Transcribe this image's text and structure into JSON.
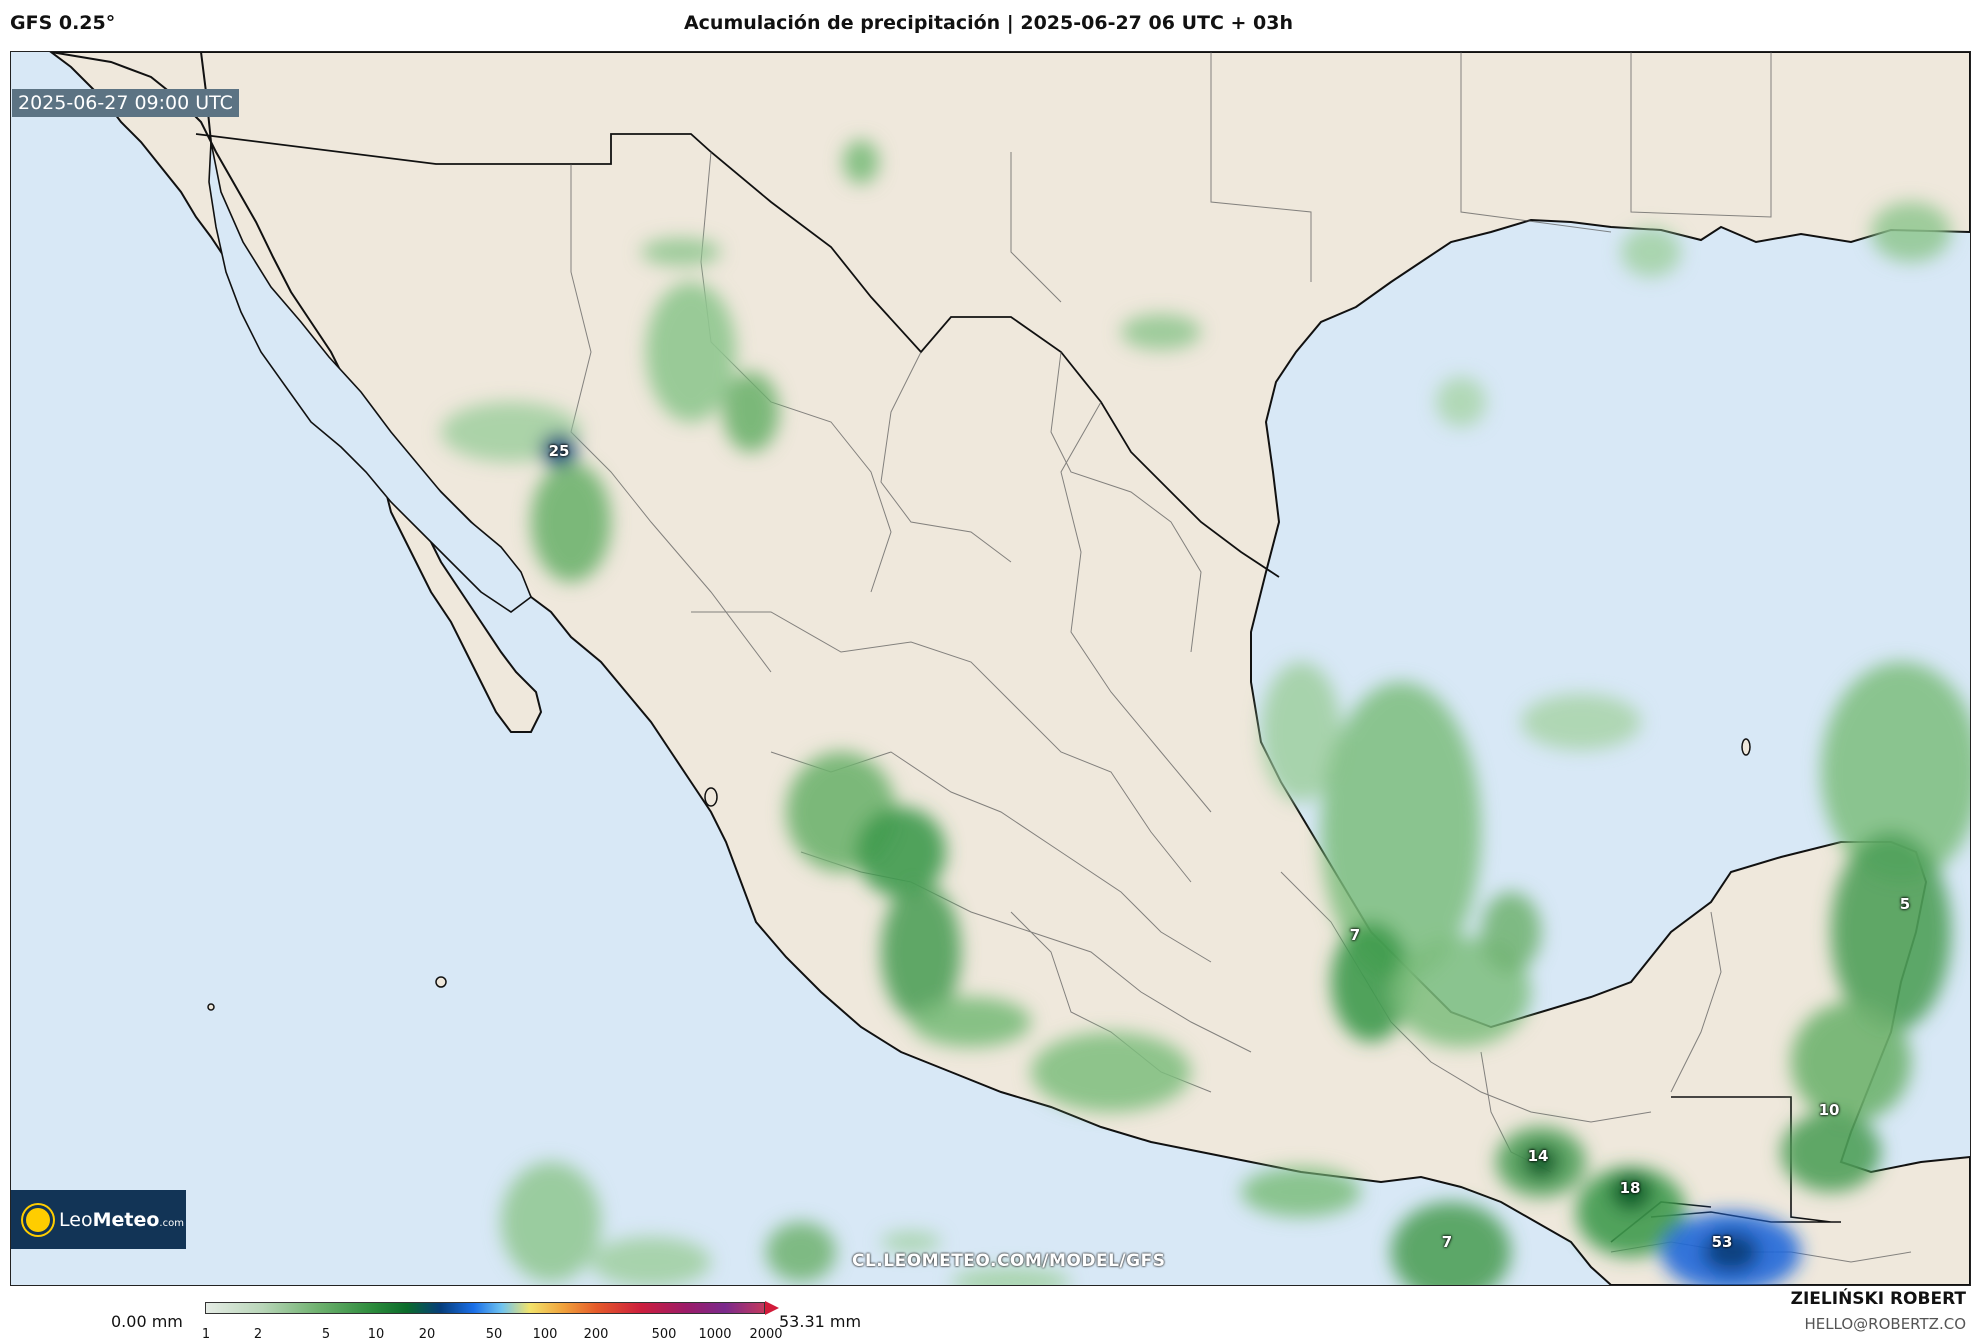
{
  "header": {
    "model": "GFS 0.25°",
    "title": "Acumulación de precipitación | 2025-06-27 06 UTC + 03h"
  },
  "map": {
    "valid_time": "2025-06-27 09:00 UTC",
    "site_url": "CL.LEOMETEO.COM/MODEL/GFS",
    "cell_labels": [
      "25",
      "5",
      "7",
      "10",
      "14",
      "18",
      "7",
      "53"
    ]
  },
  "logo": {
    "brand_light": "Leo",
    "brand_bold": "Meteo",
    "brand_suffix": ".com"
  },
  "legend": {
    "min": "0.00 mm",
    "max": "53.31 mm",
    "ticks": [
      "1",
      "2",
      "5",
      "10",
      "20",
      "50",
      "100",
      "200",
      "500",
      "1000",
      "2000"
    ]
  },
  "author": {
    "name": "ZIELIŃSKI ROBERT",
    "email": "HELLO@ROBERTZ.CO"
  },
  "colors": {
    "ocean": "#d8e8f6",
    "land": "#efe8dc",
    "precip_light": "#b9d8b9",
    "precip_mid": "#4fa05a",
    "precip_heavy": "#0b5a2a",
    "precip_extreme": "#1f66d9"
  }
}
